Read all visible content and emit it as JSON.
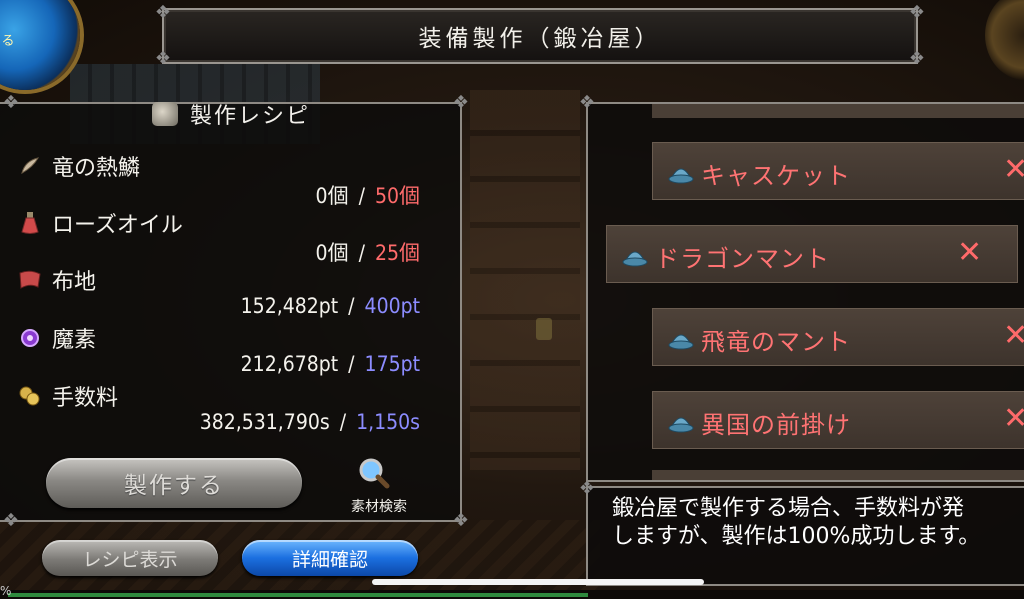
{
  "screen_title": "装備製作（鍛冶屋）",
  "orb_label": "る",
  "recipe_panel": {
    "title": "製作レシピ",
    "materials": [
      {
        "name": "竜の熱鱗",
        "owned": "0個",
        "required": "50個",
        "required_color": "#ff6b6b",
        "icon": "scale-icon"
      },
      {
        "name": "ローズオイル",
        "owned": "0個",
        "required": "25個",
        "required_color": "#ff6b6b",
        "icon": "potion-icon"
      },
      {
        "name": "布地",
        "owned": "152,482pt",
        "required": "400pt",
        "required_color": "#8c8cff",
        "icon": "cloth-icon"
      },
      {
        "name": "魔素",
        "owned": "212,678pt",
        "required": "175pt",
        "required_color": "#8c8cff",
        "icon": "magic-orb-icon"
      },
      {
        "name": "手数料",
        "owned": "382,531,790s",
        "required": "1,150s",
        "required_color": "#8c8cff",
        "icon": "coins-icon"
      }
    ],
    "separator": "/",
    "craft_button": "製作する",
    "search_label": "素材検索"
  },
  "bottom_buttons": {
    "recipe_view": "レシピ表示",
    "detail_confirm": "詳細確認"
  },
  "equipment_list": [
    {
      "name": "キャスケット",
      "mark": "✕"
    },
    {
      "name": "ドラゴンマント",
      "mark": "✕"
    },
    {
      "name": "飛竜のマント",
      "mark": "✕"
    },
    {
      "name": "異国の前掛け",
      "mark": "✕"
    }
  ],
  "message": {
    "line1": "鍛冶屋で製作する場合、手数料が発",
    "line2": "しますが、製作は100%成功します。"
  },
  "bottom_bar": {
    "percent_label": "%"
  }
}
